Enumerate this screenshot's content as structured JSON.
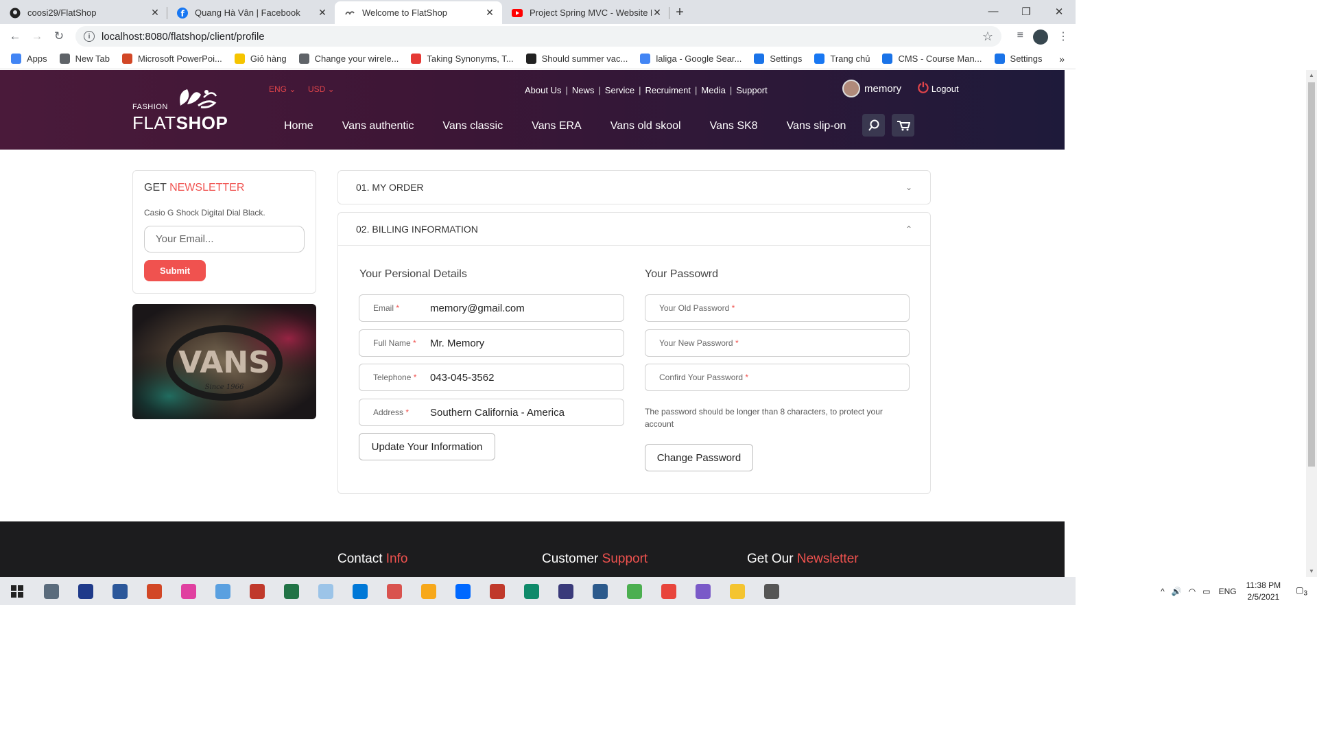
{
  "browser": {
    "tabs": [
      {
        "title": "coosi29/FlatShop",
        "icon": "github-icon",
        "active": false
      },
      {
        "title": "Quang Hà Vân | Facebook",
        "icon": "facebook-icon",
        "active": false
      },
      {
        "title": "Welcome to FlatShop",
        "icon": "flatshop-icon",
        "active": true
      },
      {
        "title": "Project Spring MVC - Website Bá",
        "icon": "youtube-icon",
        "active": false
      }
    ],
    "url": "localhost:8080/flatshop/client/profile",
    "bookmarks": [
      {
        "label": "Apps",
        "color": "#4285f4"
      },
      {
        "label": "New Tab",
        "color": "#5f6368"
      },
      {
        "label": "Microsoft PowerPoi...",
        "color": "#d24726"
      },
      {
        "label": "Giỏ hàng",
        "color": "#f5c400"
      },
      {
        "label": "Change your wirele...",
        "color": "#5f6368"
      },
      {
        "label": "Taking Synonyms, T...",
        "color": "#e53935"
      },
      {
        "label": "Should summer vac...",
        "color": "#222222"
      },
      {
        "label": "laliga - Google Sear...",
        "color": "#4285f4"
      },
      {
        "label": "Settings",
        "color": "#1a73e8"
      },
      {
        "label": "Trang chủ",
        "color": "#1877f2"
      },
      {
        "label": "CMS - Course Man...",
        "color": "#1a73e8"
      },
      {
        "label": "Settings",
        "color": "#1a73e8"
      }
    ]
  },
  "header": {
    "logo_small": "FASHION",
    "logo_flat": "FLAT",
    "logo_shop": "SHOP",
    "lang": "ENG",
    "currency": "USD",
    "toplinks": [
      "About Us",
      "News",
      "Service",
      "Recruiment",
      "Media",
      "Support"
    ],
    "username": "memory",
    "logout": "Logout",
    "nav": [
      "Home",
      "Vans authentic",
      "Vans classic",
      "Vans ERA",
      "Vans old skool",
      "Vans SK8",
      "Vans slip-on"
    ]
  },
  "sidebar": {
    "newsletter_get": "GET",
    "newsletter_word": "NEWSLETTER",
    "product": "Casio G Shock Digital Dial Black.",
    "email_placeholder": "Your Email...",
    "submit": "Submit",
    "image_text": "VANS",
    "image_sub": "Since 1966"
  },
  "profile": {
    "order_title": "01. MY ORDER",
    "billing_title": "02. BILLING INFORMATION",
    "personal_title": "Your Persional Details",
    "password_title": "Your Passowrd",
    "fields": [
      {
        "label": "Email",
        "value": "memory@gmail.com"
      },
      {
        "label": "Full Name",
        "value": "Mr. Memory"
      },
      {
        "label": "Telephone",
        "value": "043-045-3562"
      },
      {
        "label": "Address",
        "value": "Southern California - America"
      }
    ],
    "update_button": "Update Your Information",
    "password_fields": [
      "Your Old Password",
      "Your New Password",
      "Confird Your Password"
    ],
    "password_note": "The password should be longer than 8 characters, to protect your account",
    "change_button": "Change Password"
  },
  "footer": {
    "col1_a": "Contact",
    "col1_b": "Info",
    "col2_a": "Customer",
    "col2_b": "Support",
    "col3_a": "Get Our",
    "col3_b": "Newsletter"
  },
  "taskbar": {
    "lang": "ENG",
    "time": "11:38 PM",
    "date": "2/5/2021",
    "notif_count": "3",
    "apps": [
      "#5a6b7c",
      "#1f3a8a",
      "#2b579a",
      "#d24726",
      "#e040a0",
      "#5aa0e0",
      "#c0392b",
      "#217346",
      "#9cc4e8",
      "#0078d7",
      "#d9534f",
      "#f7a81b",
      "#0068ff",
      "#c0392b",
      "#0f8a6a",
      "#3a3a7a",
      "#2c5a8c",
      "#4caf50",
      "#e8453c",
      "#7a5ac8",
      "#f4c430",
      "#555555"
    ]
  },
  "colors": {
    "accent": "#f0524f",
    "header_left": "#4a1a3a",
    "header_right": "#1e1a3a"
  }
}
